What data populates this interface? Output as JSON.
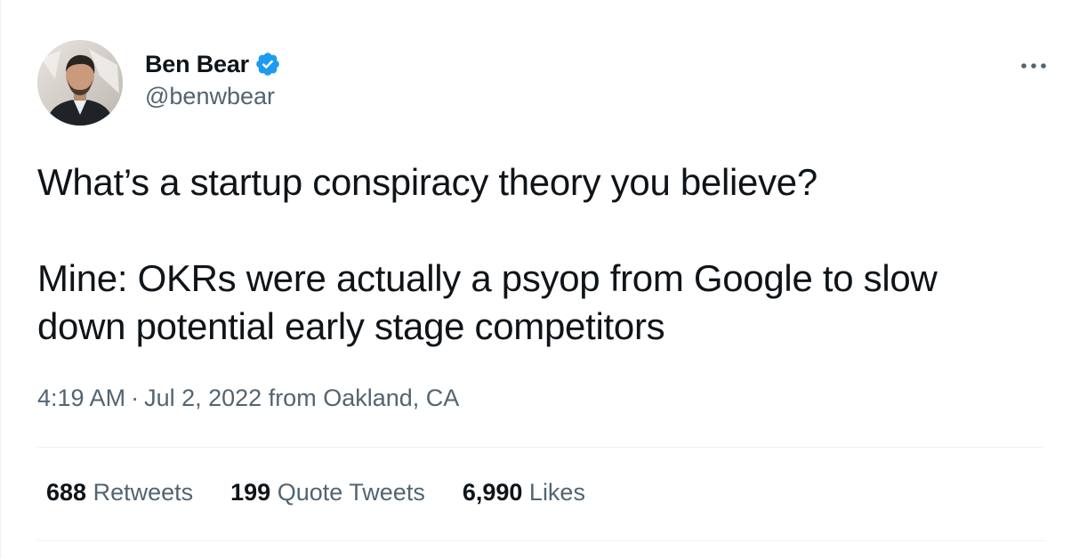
{
  "author": {
    "display_name": "Ben Bear",
    "handle": "@benwbear",
    "verified": true,
    "verified_color": "#1d9bf0"
  },
  "tweet": {
    "lines": [
      "What’s a startup conspiracy theory you believe?",
      "Mine: OKRs were actually a psyop from Google to slow down potential early stage competitors"
    ]
  },
  "meta": {
    "time": "4:19 AM",
    "separator": "·",
    "date": "Jul 2, 2022",
    "location": "from Oakland, CA"
  },
  "stats": [
    {
      "count": "688",
      "label": "Retweets"
    },
    {
      "count": "199",
      "label": "Quote Tweets"
    },
    {
      "count": "6,990",
      "label": "Likes"
    }
  ],
  "icons": {
    "more": "more-horizontal-icon",
    "verified": "verified-badge-icon"
  },
  "colors": {
    "text_primary": "#0f1419",
    "text_secondary": "#536471",
    "divider": "#eff3f4"
  }
}
